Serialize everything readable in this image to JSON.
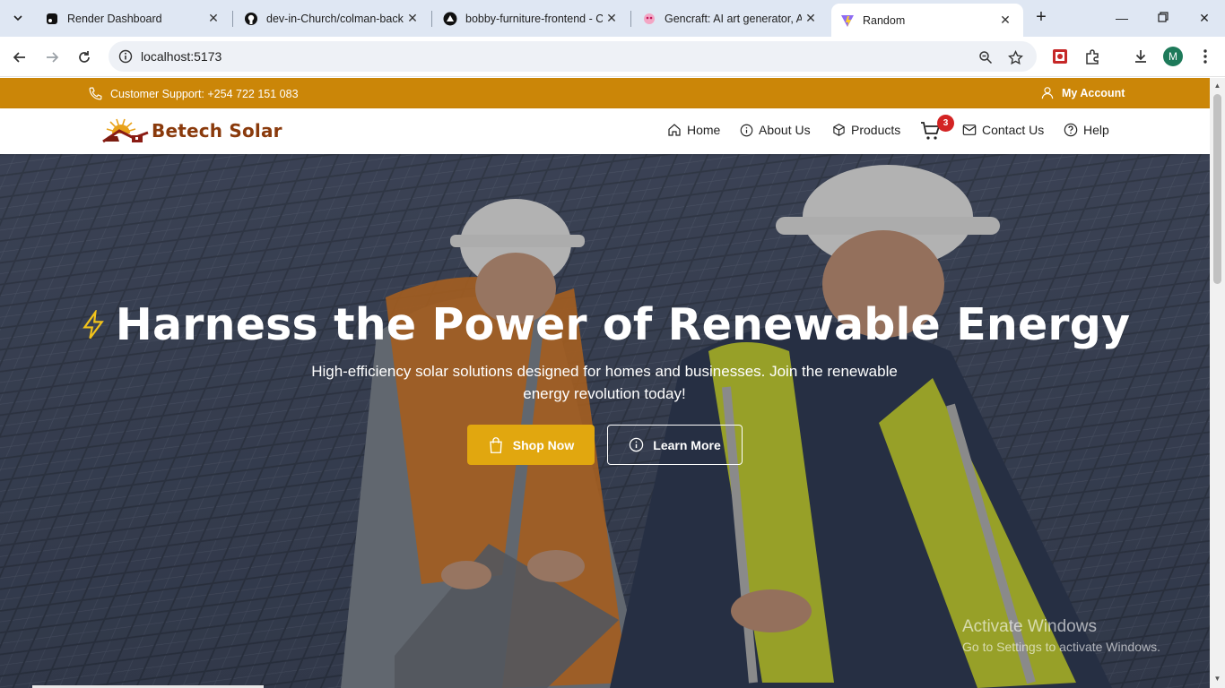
{
  "browser": {
    "tabs": [
      {
        "title": "Render Dashboard",
        "icon": "render-icon"
      },
      {
        "title": "dev-in-Church/colman-back",
        "icon": "github-icon"
      },
      {
        "title": "bobby-furniture-frontend - C",
        "icon": "vercel-icon"
      },
      {
        "title": "Gencraft: AI art generator, A",
        "icon": "gencraft-icon"
      },
      {
        "title": "Random",
        "icon": "vite-icon",
        "active": true
      }
    ],
    "url": "localhost:5173",
    "profile_initial": "M"
  },
  "topbar": {
    "support": "Customer Support: +254 722 151 083",
    "account": "My Account"
  },
  "navbar": {
    "brand": "Betech Solar",
    "links": [
      "Home",
      "About Us",
      "Products",
      "Contact Us",
      "Help"
    ],
    "cart_count": "3"
  },
  "hero": {
    "title": "Harness the Power of Renewable Energy",
    "subtitle": "High-efficiency solar solutions designed for homes and businesses. Join the renewable energy revolution today!",
    "shop_label": "Shop Now",
    "learn_label": "Learn More"
  },
  "os": {
    "activate_title": "Activate Windows",
    "activate_sub": "Go to Settings to activate Windows."
  },
  "colors": {
    "topbar": "#cb8608",
    "brand_text": "#8a3a0c",
    "shop_button": "#e1a70f",
    "cart_badge": "#d32323"
  }
}
